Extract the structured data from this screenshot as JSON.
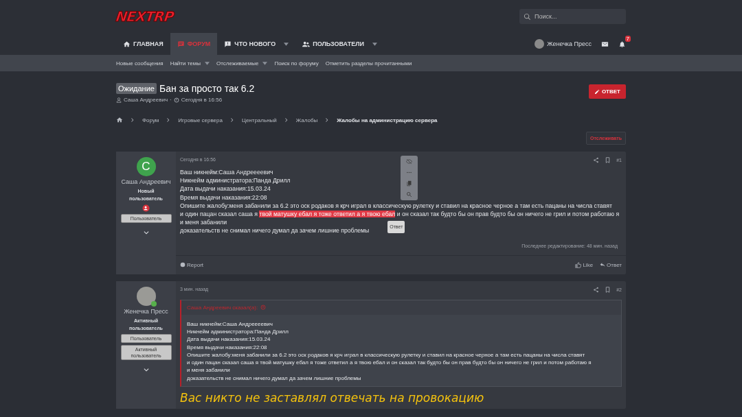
{
  "header": {
    "logo": "NEXTRP",
    "search": {
      "placeholder": "Поиск..."
    }
  },
  "nav": {
    "tabs": [
      {
        "label": "ГЛАВНАЯ",
        "selected": false,
        "dropdown": false
      },
      {
        "label": "ФОРУМ",
        "selected": true,
        "dropdown": false
      },
      {
        "label": "ЧТО НОВОГО",
        "selected": false,
        "dropdown": true
      },
      {
        "label": "ПОЛЬЗОВАТЕЛИ",
        "selected": false,
        "dropdown": true
      }
    ],
    "user": "Женечка Пресс",
    "alerts_badge": "7"
  },
  "subnav": [
    {
      "label": "Новые сообщения",
      "dropdown": false
    },
    {
      "label": "Найти темы",
      "dropdown": true
    },
    {
      "label": "Отслеживаемые",
      "dropdown": true
    },
    {
      "label": "Поиск по форуму",
      "dropdown": false
    },
    {
      "label": "Отметить разделы прочитанными",
      "dropdown": false
    }
  ],
  "thread": {
    "prefix": "Ожидание",
    "title": "Бан за просто так 6.2",
    "author": "Саша Андреевич",
    "separator": "·",
    "time": "Сегодня в 16:56",
    "reply_button": "ОТВЕТ",
    "watch_button": "Отслеживать"
  },
  "breadcrumbs": [
    {
      "label": "Форум",
      "current": false
    },
    {
      "label": "Игровые сервера",
      "current": false
    },
    {
      "label": "Центральный",
      "current": false
    },
    {
      "label": "Жалобы",
      "current": false
    },
    {
      "label": "Жалобы на администрацию сервера",
      "current": true
    }
  ],
  "posts": [
    {
      "author": "Саша Андреевич",
      "avatar": {
        "kind": "letter",
        "letter": "C",
        "color": "#3fa34d"
      },
      "role": "Новый пользователь",
      "banners": [
        "Пользователь"
      ],
      "time": "Сегодня в 16:56",
      "number": "#1",
      "lines": [
        [
          {
            "text": "Ваш никнейм:Саша Андреееевич",
            "highlighted": false
          }
        ],
        [
          {
            "text": "Никнейм администратора:Панда Дрилл",
            "highlighted": false
          }
        ],
        [
          {
            "text": "Дата выдачи наказания:15.03.24",
            "highlighted": false
          }
        ],
        [
          {
            "text": "Время выдачи наказания:22:08",
            "highlighted": false
          }
        ],
        [
          {
            "text": "Опишите жалобу:меня забанили за 6.2 это оск родаков я крч играл в классическую рулетку и ставил на красное черное а там есть пацаны на числа ставят",
            "highlighted": false
          }
        ],
        [
          {
            "text": "и один пацан сказал саша я ",
            "highlighted": false
          },
          {
            "text": "твой матушку ебал я тоже ответил а я твою ебал",
            "highlighted": true
          },
          {
            "text": " и он сказал так будто бы он прав будто бы он ничего не грил и потом работаю я",
            "highlighted": false
          }
        ],
        [
          {
            "text": "и меня забанили",
            "highlighted": false
          }
        ],
        [
          {
            "text": "доказательств не снимал ничего думал да зачем лишние проблемы",
            "highlighted": false
          }
        ]
      ],
      "selection_tooltip": "Ответ",
      "edited": "Последнее редактирование: 48 мин. назад",
      "report": "Report",
      "like": "Like",
      "reply": "Ответ"
    },
    {
      "author": "Женечка Пресс",
      "avatar": {
        "kind": "photo"
      },
      "role": "Активный пользователь",
      "banners": [
        "Пользователь",
        "Активный пользователь"
      ],
      "time": "3 мин. назад",
      "number": "#2",
      "quote": {
        "header": "Саша Андреевич сказал(а):",
        "lines": [
          "Ваш никнейм:Саша Андреееевич",
          "Никнейм администратора:Панда Дрилл",
          "Дата выдачи наказания:15.03.24",
          "Время выдачи наказания:22:08",
          "Опишите жалобу:меня забанили за 6.2 это оск родаков я крч играл в классическую рулетку и ставил на красное черное а там есть пацаны на числа ставят",
          "и один пацан сказал саша я твой матушку ебал я тоже ответил а я твою ебал и он сказал так будто бы он прав будто бы он ничего не грил и потом работаю я",
          "и меня забанили",
          "доказательств не снимал ничего думал да зачем лишние проблемы"
        ]
      },
      "big_text": "Вас никто не заставлял отвечать на провокацию"
    }
  ]
}
